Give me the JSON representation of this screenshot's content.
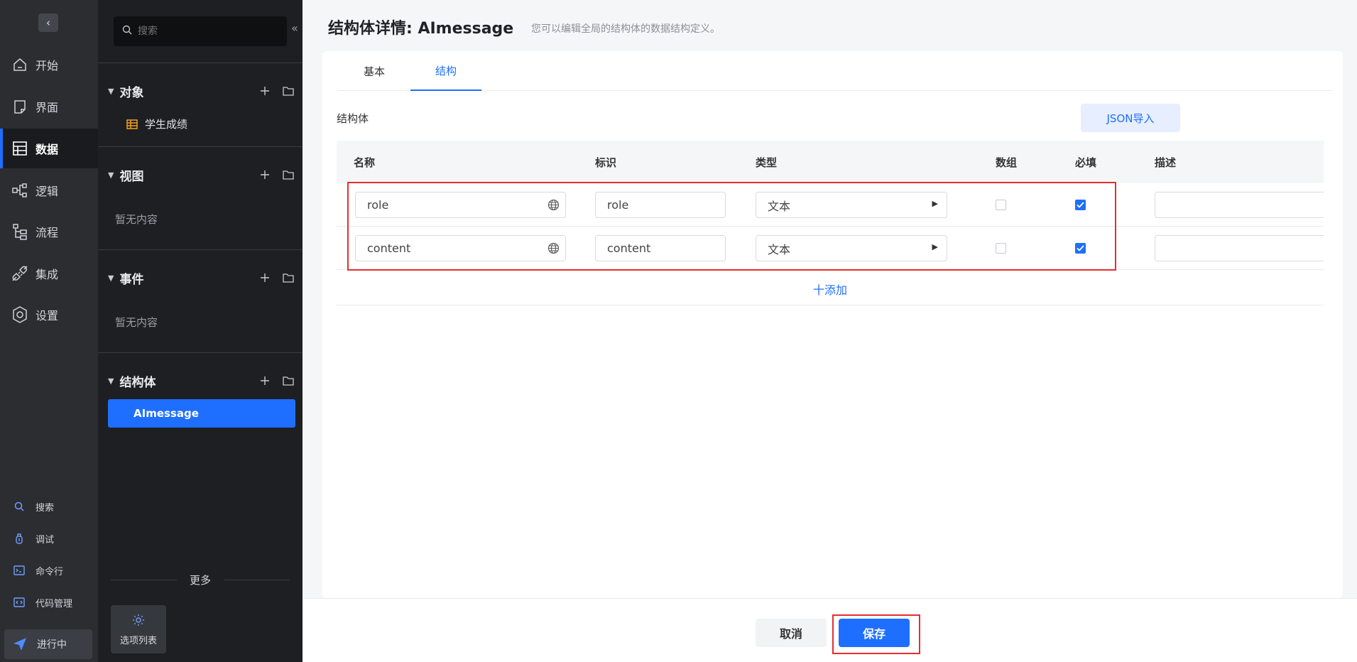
{
  "rail": {
    "items": [
      {
        "label": "开始",
        "icon": "home-icon"
      },
      {
        "label": "界面",
        "icon": "page-icon"
      },
      {
        "label": "数据",
        "icon": "table-icon"
      },
      {
        "label": "逻辑",
        "icon": "logic-icon"
      },
      {
        "label": "流程",
        "icon": "flow-icon"
      },
      {
        "label": "集成",
        "icon": "plug-icon"
      },
      {
        "label": "设置",
        "icon": "gear-icon"
      }
    ],
    "active": "数据",
    "bottom": [
      {
        "label": "搜索",
        "icon": "search-icon"
      },
      {
        "label": "调试",
        "icon": "debug-icon"
      },
      {
        "label": "命令行",
        "icon": "terminal-icon"
      },
      {
        "label": "代码管理",
        "icon": "code-icon"
      }
    ],
    "running_label": "进行中"
  },
  "explorer": {
    "search_placeholder": "搜索",
    "sections": {
      "object": {
        "title": "对象",
        "items": [
          "学生成绩"
        ]
      },
      "view": {
        "title": "视图",
        "empty": "暂无内容"
      },
      "event": {
        "title": "事件",
        "empty": "暂无内容"
      },
      "struct": {
        "title": "结构体",
        "items": [
          "AImessage"
        ]
      }
    },
    "more_label": "更多",
    "options_label": "选项列表"
  },
  "main": {
    "title": "结构体详情: AImessage",
    "description": "您可以编辑全局的结构体的数据结构定义。",
    "tabs": [
      "基本",
      "结构"
    ],
    "active_tab": "结构",
    "struct_label": "结构体",
    "json_import": "JSON导入",
    "columns": [
      "名称",
      "标识",
      "类型",
      "数组",
      "必填",
      "描述"
    ],
    "rows": [
      {
        "name": "role",
        "identifier": "role",
        "type": "文本",
        "is_array": false,
        "required": true,
        "description": ""
      },
      {
        "name": "content",
        "identifier": "content",
        "type": "文本",
        "is_array": false,
        "required": true,
        "description": ""
      }
    ],
    "add_label": "十添加"
  },
  "footer": {
    "cancel": "取消",
    "save": "保存"
  },
  "colors": {
    "accent": "#1e6fff",
    "rail_bg": "#2b2d31",
    "explorer_bg": "#1e1f22",
    "highlight": "#e52e2e"
  }
}
